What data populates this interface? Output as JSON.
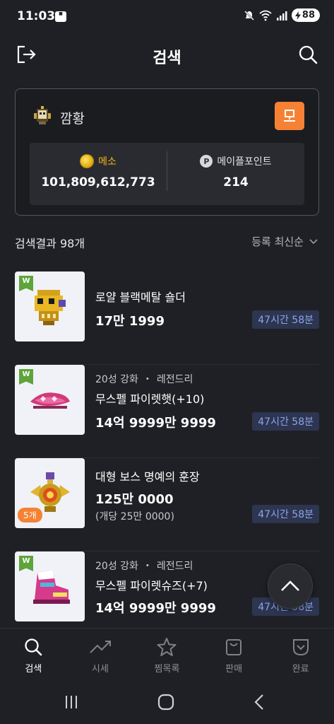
{
  "status_bar": {
    "time": "11:03",
    "battery": "88"
  },
  "header": {
    "title": "검색"
  },
  "profile": {
    "character_name": "깜황",
    "meso_label": "메소",
    "meso_value": "101,809,612,773",
    "point_icon": "P",
    "point_label": "메이플포인트",
    "point_value": "214"
  },
  "results": {
    "count_label": "검색결과 98개",
    "sort_label": "등록 최신순"
  },
  "items": [
    {
      "name": "로얄 블랙메탈 숄더",
      "price": "17만 1999",
      "timer": "47시간 58분",
      "badge": "W"
    },
    {
      "meta_star": "20성 강화",
      "meta_potential": "레전드리",
      "name": "무스펠 파이렛햇(+10)",
      "price": "14억 9999만 9999",
      "timer": "47시간 58분",
      "badge": "W"
    },
    {
      "name": "대형 보스 명예의 훈장",
      "price": "125만 0000",
      "unit_price": "(개당 25만 0000)",
      "timer": "47시간 58분",
      "quantity": "5개"
    },
    {
      "meta_star": "20성 강화",
      "meta_potential": "레전드리",
      "name": "무스펠 파이렛슈즈(+7)",
      "price": "14억 9999만 9999",
      "timer": "47시간 58분",
      "badge": "W"
    }
  ],
  "bottom_nav": [
    {
      "label": "검색",
      "icon": "search-icon",
      "active": true
    },
    {
      "label": "시세",
      "icon": "trend-icon",
      "active": false
    },
    {
      "label": "찜목록",
      "icon": "star-icon",
      "active": false
    },
    {
      "label": "판매",
      "icon": "shopping-bag-icon",
      "active": false
    },
    {
      "label": "완료",
      "icon": "check-pocket-icon",
      "active": false
    }
  ],
  "colors": {
    "background": "#1f2025",
    "accent_orange": "#f58234",
    "meso_gold": "#f7b41a",
    "timer_bg": "#2d3550",
    "timer_text": "#8ea4e8"
  }
}
